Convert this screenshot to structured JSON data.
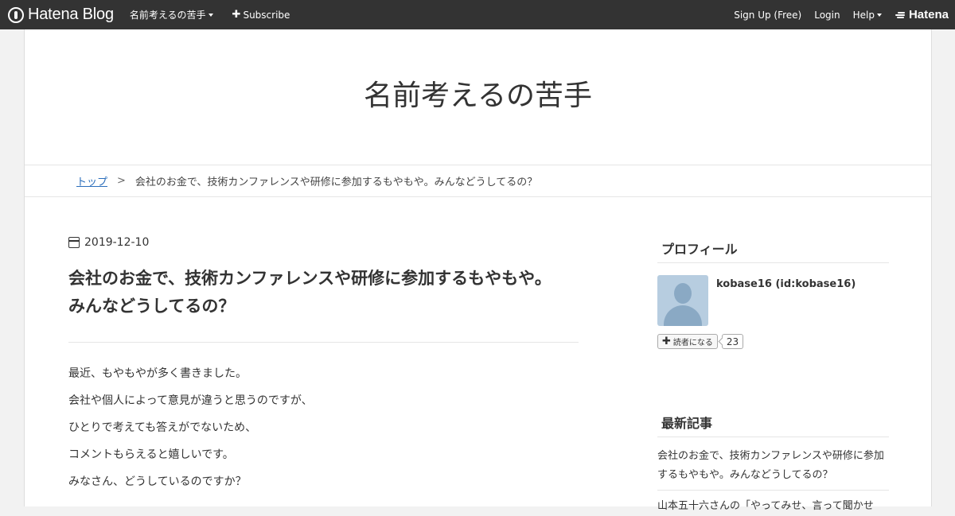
{
  "topbar": {
    "brand": "Hatena Blog",
    "blog_menu": "名前考えるの苦手",
    "subscribe": "Subscribe",
    "signup": "Sign Up (Free)",
    "login": "Login",
    "help": "Help",
    "hatena": "Hatena"
  },
  "blog": {
    "title": "名前考えるの苦手"
  },
  "breadcrumb": {
    "top": "トップ",
    "separator": ">",
    "current": "会社のお金で、技術カンファレンスや研修に参加するもやもや。みんなどうしてるの？"
  },
  "entry": {
    "date": "2019-12-10",
    "title_line1": "会社のお金で、技術カンファレンスや研修に参加するもやもや。",
    "title_line2": "みんなどうしてるの？",
    "paragraphs": [
      "最近、もやもやが多く書きました。",
      "会社や個人によって意見が違うと思うのですが、",
      "ひとりで考えても答えがでないため、",
      "コメントもらえると嬉しいです。",
      "みなさん、どうしているのですか？"
    ]
  },
  "sidebar": {
    "profile_title": "プロフィール",
    "profile_name": "kobase16 (id:kobase16)",
    "reader_button": "読者になる",
    "reader_count": "23",
    "recent_title": "最新記事",
    "recent_items": [
      "会社のお金で、技術カンファレンスや研修に参加するもやもや。みんなどうしてるの？",
      "山本五十六さんの「やってみせ、言って聞かせ"
    ]
  }
}
